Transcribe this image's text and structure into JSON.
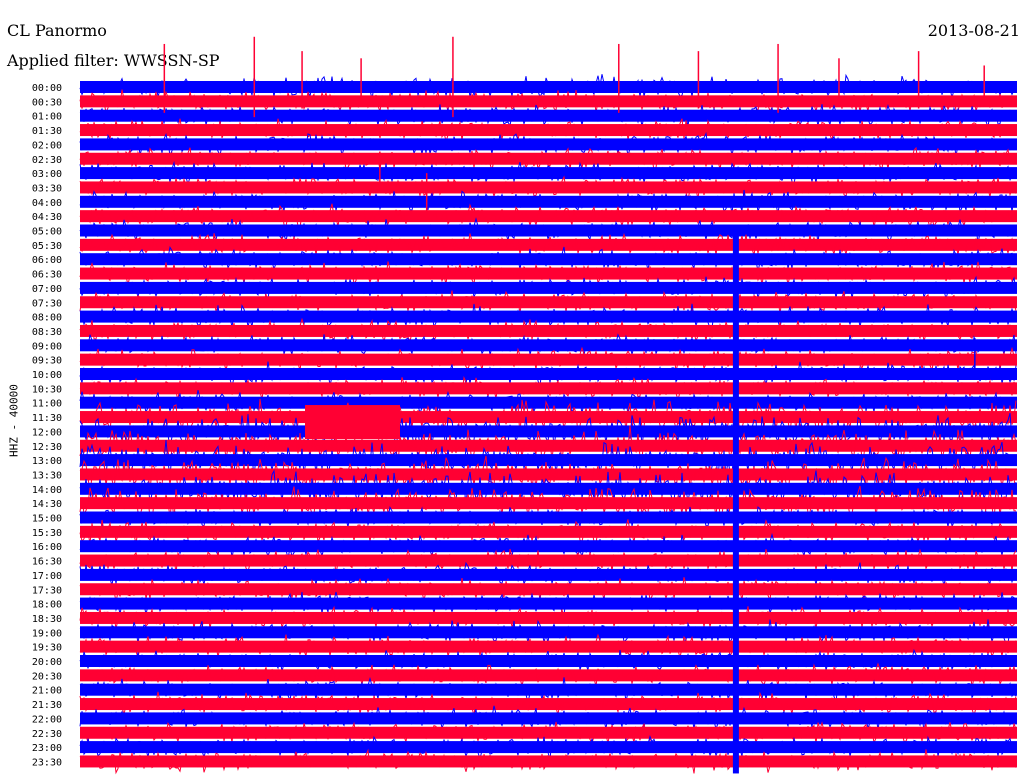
{
  "header": {
    "station": "CL Panormo",
    "date": "2013-08-21",
    "filter": "Applied filter: WWSSN-SP"
  },
  "chart_data": {
    "type": "line",
    "title": "CL Panormo",
    "channel_label": "HHZ - 40000",
    "colors": {
      "even_rows": "#0000ff",
      "odd_rows": "#ff0033"
    },
    "rows": [
      "00:00",
      "00:30",
      "01:00",
      "01:30",
      "02:00",
      "02:30",
      "03:00",
      "03:30",
      "04:00",
      "04:30",
      "05:00",
      "05:30",
      "06:00",
      "06:30",
      "07:00",
      "07:30",
      "08:00",
      "08:30",
      "09:00",
      "09:30",
      "10:00",
      "10:30",
      "11:00",
      "11:30",
      "12:00",
      "12:30",
      "13:00",
      "13:30",
      "14:00",
      "14:30",
      "15:00",
      "15:30",
      "16:00",
      "16:30",
      "17:00",
      "17:30",
      "18:00",
      "18:30",
      "19:00",
      "19:30",
      "20:00",
      "20:30",
      "21:00",
      "21:30",
      "22:00",
      "22:30",
      "23:00",
      "23:30"
    ],
    "spikes": [
      {
        "row": 0,
        "x_fraction": 0.09,
        "height_rows": 3.0
      },
      {
        "row": 0,
        "x_fraction": 0.186,
        "height_rows": 3.5
      },
      {
        "row": 0,
        "x_fraction": 0.237,
        "height_rows": 2.5
      },
      {
        "row": 0,
        "x_fraction": 0.3,
        "height_rows": 2.0
      },
      {
        "row": 0,
        "x_fraction": 0.398,
        "height_rows": 3.5
      },
      {
        "row": 0,
        "x_fraction": 0.575,
        "height_rows": 3.0
      },
      {
        "row": 0,
        "x_fraction": 0.66,
        "height_rows": 2.5
      },
      {
        "row": 0,
        "x_fraction": 0.745,
        "height_rows": 3.0
      },
      {
        "row": 0,
        "x_fraction": 0.81,
        "height_rows": 2.0
      },
      {
        "row": 0,
        "x_fraction": 0.895,
        "height_rows": 2.5
      },
      {
        "row": 0,
        "x_fraction": 0.965,
        "height_rows": 1.5
      },
      {
        "row": 6,
        "x_fraction": 0.32,
        "height_rows": 1.5
      },
      {
        "row": 8,
        "x_fraction": 0.37,
        "height_rows": 2.0
      },
      {
        "row": 19,
        "x_fraction": 0.955,
        "height_rows": 1.5
      }
    ],
    "long_event": {
      "x_fraction": 0.7,
      "from_row": 10,
      "to_row": 47
    }
  }
}
